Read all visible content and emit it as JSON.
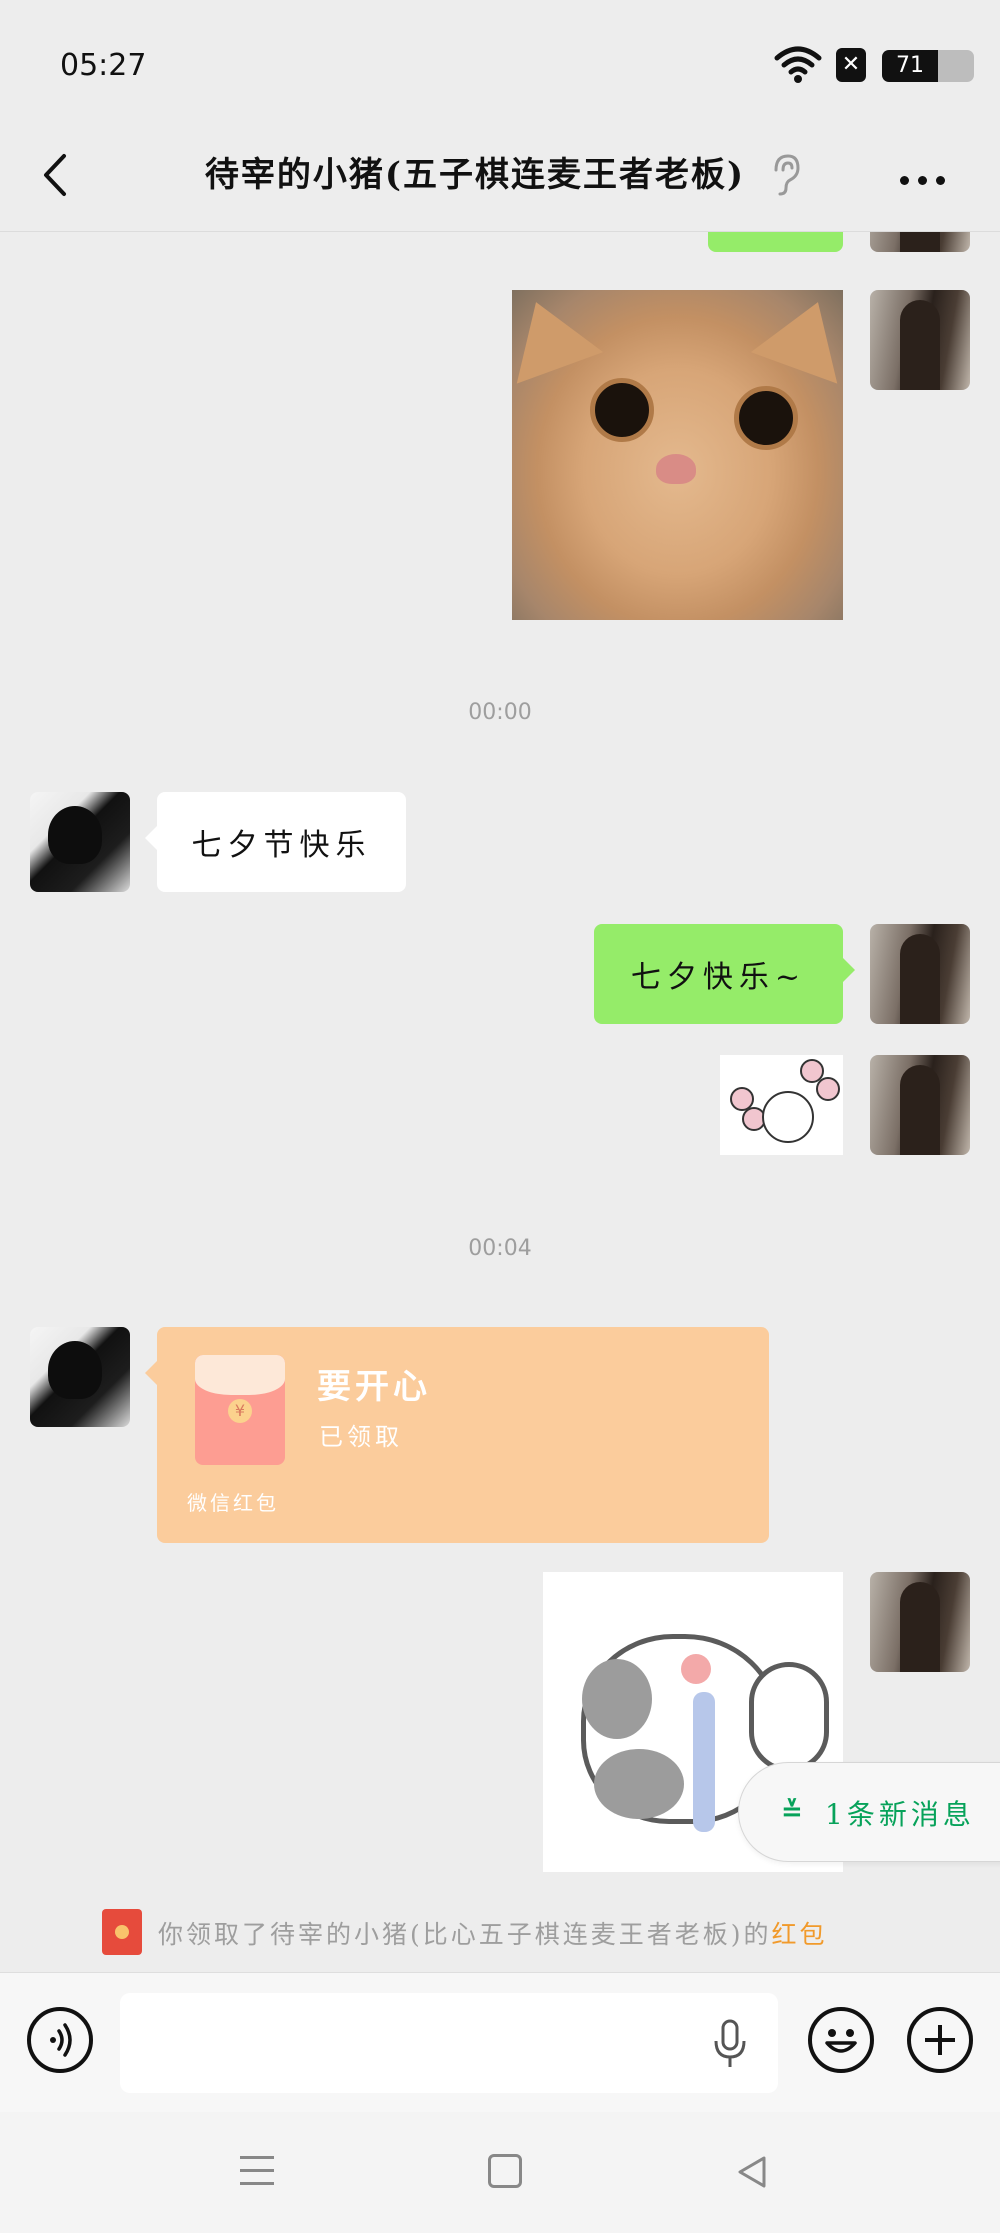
{
  "status_bar": {
    "time": "05:27",
    "battery_level": "71",
    "icons": [
      "wifi-icon",
      "x-icon",
      "battery-icon"
    ]
  },
  "header": {
    "title": "待宰的小猪(五子棋连麦王者老板)",
    "icons": [
      "back-icon",
      "ear-icon",
      "more-icon"
    ]
  },
  "chat": {
    "timestamps": [
      "00:00",
      "00:04"
    ],
    "messages": [
      {
        "from": "other",
        "type": "text",
        "text": "七夕节快乐"
      },
      {
        "from": "self",
        "type": "text",
        "text": "七夕快乐~"
      }
    ],
    "red_packet": {
      "title": "要开心",
      "status": "已领取",
      "footer": "微信红包"
    },
    "new_message_badge": "1条新消息",
    "system_note": {
      "prefix": "你领取了待宰的小猪(比心五子棋连麦王者老板)的",
      "link": "红包"
    }
  },
  "input_bar": {
    "placeholder": "",
    "icons": [
      "voice-icon",
      "mic-icon",
      "emoji-icon",
      "plus-icon"
    ]
  },
  "colors": {
    "bubble_self": "#95ec69",
    "bubble_other": "#ffffff",
    "red_packet": "#fbcc9c",
    "accent_green": "#07a25a",
    "link_orange": "#f19a2b",
    "background": "#ededed"
  }
}
